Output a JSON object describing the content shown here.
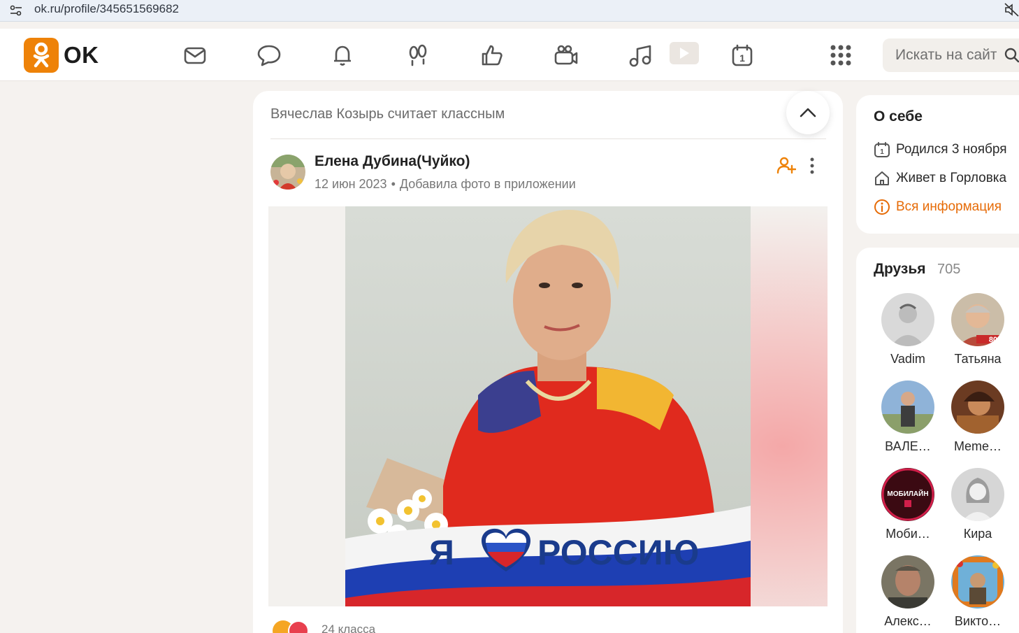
{
  "browser": {
    "url": "ok.ru/profile/345651569682"
  },
  "header": {
    "logo_text": "OK",
    "brand_color": "#ee8208",
    "nav_icons": [
      "mail-icon",
      "chat-icon",
      "bell-icon",
      "guests-icon",
      "likes-icon",
      "video-icon",
      "music-icon",
      "play-icon",
      "calendar-icon",
      "apps-grid-icon"
    ],
    "calendar_day": "1",
    "search_placeholder": "Искать на сайте"
  },
  "feed": {
    "liked_by": "Вячеслав Козырь считает классным",
    "post": {
      "author": "Елена Дубина(Чуйко)",
      "date": "12 июн 2023",
      "action": "Добавила фото в приложении",
      "photo_caption_left": "Я",
      "photo_caption_right": "РОССИЮ",
      "reactions_count": "24 класса"
    }
  },
  "about": {
    "title": "О себе",
    "birthday": "Родился 3 ноября",
    "lives": "Живет в Горловка",
    "all_info": "Вся информация",
    "calendar_day": "1"
  },
  "friends": {
    "title": "Друзья",
    "count": "705",
    "list": [
      {
        "name": "Vadim"
      },
      {
        "name": "Татьяна",
        "badge": "80"
      },
      {
        "name": "ВАЛЕ…"
      },
      {
        "name": "Meme…"
      },
      {
        "name": "Моби…",
        "logo_text": "МОБИЛАЙН"
      },
      {
        "name": "Кира"
      },
      {
        "name": "Алекс…"
      },
      {
        "name": "Викто…"
      }
    ]
  }
}
